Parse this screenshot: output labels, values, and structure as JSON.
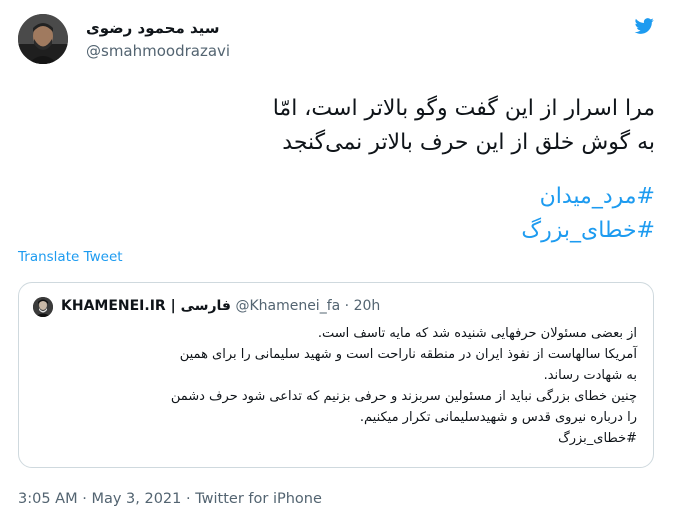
{
  "author": {
    "display_name": "سید محمود رضوی",
    "handle": "@smahmoodrazavi"
  },
  "tweet": {
    "lines": [
      "مرا اسرار از این گفت وگو بالاتر است، امّا",
      "به گوش خلق از این حرف بالاتر نمی‌گنجد"
    ],
    "hashtags": [
      "#مرد_میدان",
      "#خطای_بزرگ"
    ],
    "translate_label": "Translate Tweet"
  },
  "quoted": {
    "name": "KHAMENEI.IR | فارسی",
    "handle": "@Khamenei_fa",
    "separator": "·",
    "time": "20h",
    "lines": [
      "از بعضی مسئولان حرفهایی شنیده شد که مایه تاسف است.",
      "آمریکا سالهاست از نفوذ ایران در منطقه ناراحت است و شهید سلیمانی را برای همین",
      "به شهادت رساند.",
      "چنین خطای بزرگی نباید از مسئولین سربزند و حرفی بزنیم که تداعی شود حرف دشمن",
      "را درباره نیروی قدس و شهیدسلیمانی تکرار میکنیم."
    ],
    "hashtag": "#خطای_بزرگ"
  },
  "meta": {
    "time": "3:05 AM",
    "date": "May 3, 2021",
    "source": "Twitter for iPhone",
    "separator": "·"
  },
  "icons": {
    "twitter_logo": "twitter-bird-icon",
    "brand_color": "#1d9bf0"
  }
}
